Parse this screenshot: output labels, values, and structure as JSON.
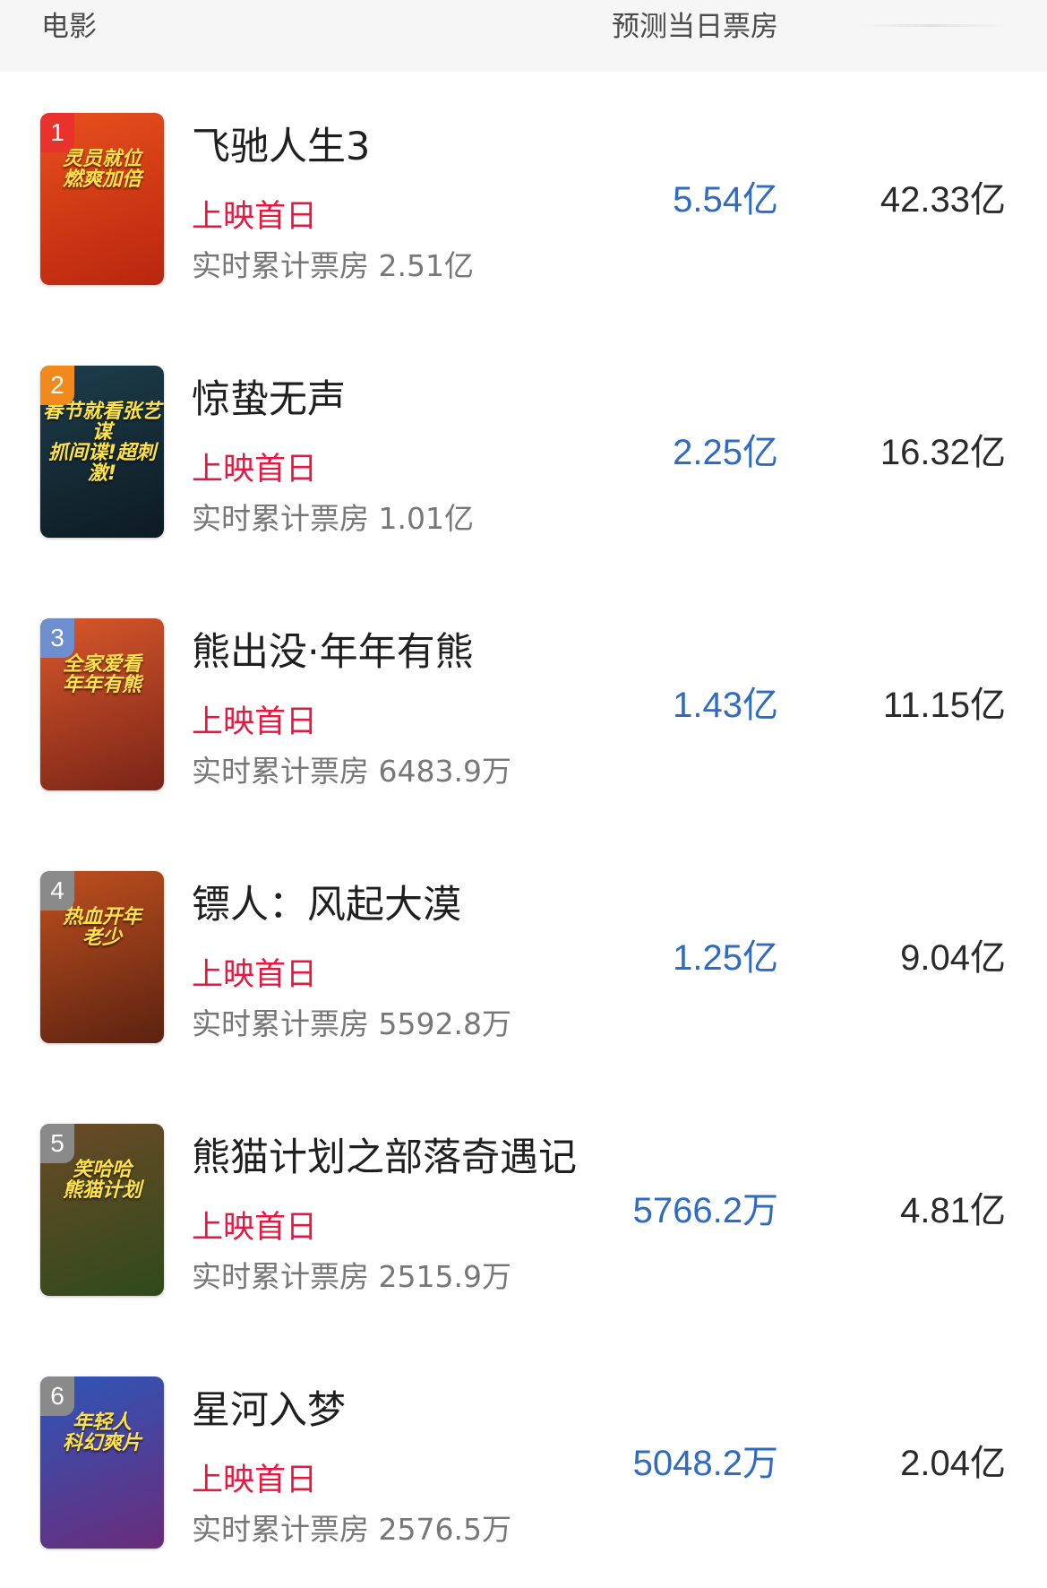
{
  "header": {
    "col_movie": "电影",
    "col_predict": "预测当日票房"
  },
  "movies": [
    {
      "rank": "1",
      "title": "飞驰人生3",
      "status": "上映首日",
      "cumulative": "实时累计票房 2.51亿",
      "predict": "5.54亿",
      "total": "42.33亿",
      "poster_text": "灵员就位\n燃爽加倍",
      "poster_colors": [
        "#e8501c",
        "#b8260f"
      ],
      "rank_color": "#e8322b"
    },
    {
      "rank": "2",
      "title": "惊蛰无声",
      "status": "上映首日",
      "cumulative": "实时累计票房 1.01亿",
      "predict": "2.25亿",
      "total": "16.32亿",
      "poster_text": "春节就看张艺谋\n抓间谍!超刺激!",
      "poster_colors": [
        "#1d3e4c",
        "#0d1a22"
      ],
      "rank_color": "#f08a1c"
    },
    {
      "rank": "3",
      "title": "熊出没·年年有熊",
      "status": "上映首日",
      "cumulative": "实时累计票房 6483.9万",
      "predict": "1.43亿",
      "total": "11.15亿",
      "poster_text": "全家爱看\n年年有熊",
      "poster_colors": [
        "#d8582a",
        "#7a2418"
      ],
      "rank_color": "#6d8fd0"
    },
    {
      "rank": "4",
      "title": "镖人：风起大漠",
      "status": "上映首日",
      "cumulative": "实时累计票房 5592.8万",
      "predict": "1.25亿",
      "total": "9.04亿",
      "poster_text": "热血开年\n老少",
      "poster_colors": [
        "#c0501f",
        "#5b2211"
      ],
      "rank_color": "#8a8a8a"
    },
    {
      "rank": "5",
      "title": "熊猫计划之部落奇遇记",
      "status": "上映首日",
      "cumulative": "实时累计票房 2515.9万",
      "predict": "5766.2万",
      "total": "4.81亿",
      "poster_text": "笑哈哈\n熊猫计划",
      "poster_colors": [
        "#6b4a26",
        "#2f4a1c"
      ],
      "rank_color": "#8a8a8a"
    },
    {
      "rank": "6",
      "title": "星河入梦",
      "status": "上映首日",
      "cumulative": "实时累计票房 2576.5万",
      "predict": "5048.2万",
      "total": "2.04亿",
      "poster_text": "年轻人\n科幻爽片",
      "poster_colors": [
        "#2e56b8",
        "#6a2c7a"
      ],
      "rank_color": "#8a8a8a"
    }
  ]
}
